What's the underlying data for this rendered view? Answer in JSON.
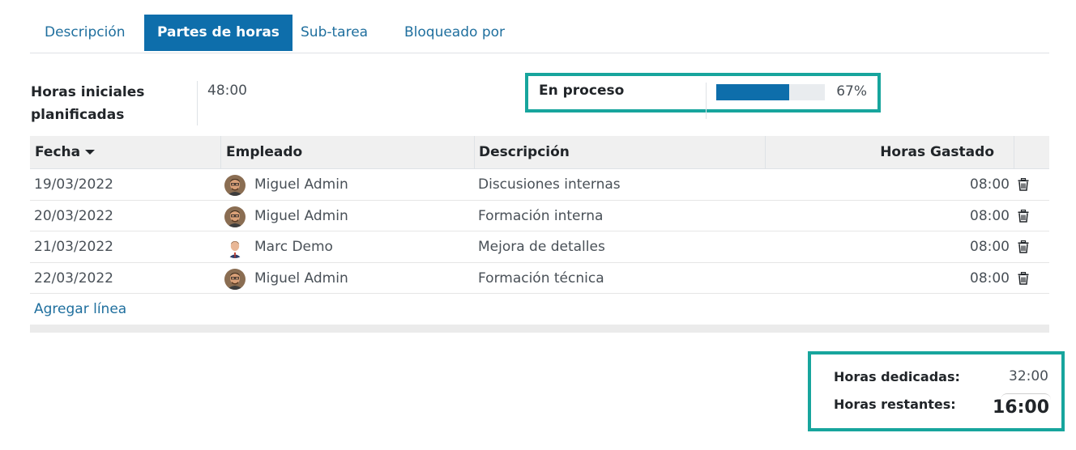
{
  "tabs": [
    {
      "label": "Descripción",
      "active": false
    },
    {
      "label": "Partes de horas",
      "active": true
    },
    {
      "label": "Sub-tarea",
      "active": false
    },
    {
      "label": "Bloqueado por",
      "active": false
    }
  ],
  "planned": {
    "label": "Horas iniciales planificadas",
    "value": "48:00"
  },
  "progress": {
    "label": "En proceso",
    "percent_text": "67%",
    "percent": 67
  },
  "table": {
    "headers": {
      "date": "Fecha",
      "employee": "Empleado",
      "description": "Descripción",
      "hours": "Horas Gastado"
    },
    "rows": [
      {
        "date": "19/03/2022",
        "employee": "Miguel Admin",
        "description": "Discusiones internas",
        "hours": "08:00",
        "avatar": "miguel-avatar"
      },
      {
        "date": "20/03/2022",
        "employee": "Miguel Admin",
        "description": "Formación interna",
        "hours": "08:00",
        "avatar": "miguel-avatar"
      },
      {
        "date": "21/03/2022",
        "employee": "Marc Demo",
        "description": "Mejora de detalles",
        "hours": "08:00",
        "avatar": "marc-avatar"
      },
      {
        "date": "22/03/2022",
        "employee": "Miguel Admin",
        "description": "Formación técnica",
        "hours": "08:00",
        "avatar": "miguel-avatar"
      }
    ],
    "add_line": "Agregar línea"
  },
  "summary": {
    "spent_label": "Horas dedicadas:",
    "spent_value": "32:00",
    "remaining_label": "Horas restantes:",
    "remaining_value": "16:00"
  },
  "colors": {
    "accent": "#0e6eab",
    "highlight_border": "#17a59d",
    "link": "#1f6f9e"
  }
}
